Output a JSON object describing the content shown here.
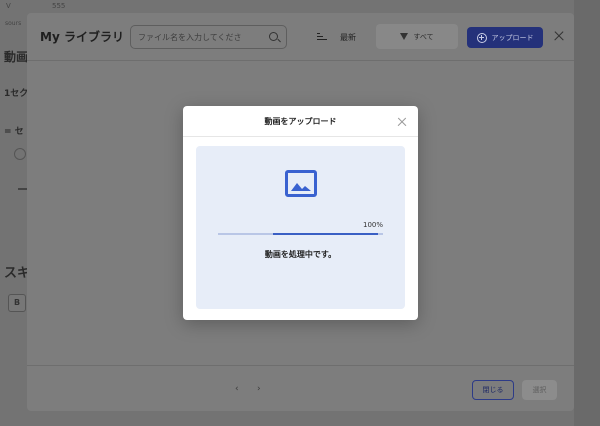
{
  "background": {
    "top_a": "V",
    "top_b": "555",
    "top_c": "sours",
    "heading1": "動画",
    "heading2": "1セク",
    "heading3": "= セ",
    "heading4": "スキ",
    "chip": "B"
  },
  "library": {
    "title": "My ライブラリ",
    "search_placeholder": "ファイル名を入力してくださ",
    "sort_label": "最新",
    "filter_label": "すべて",
    "upload_label": "アップロード",
    "pager_prev": "‹",
    "pager_next": "›",
    "close_label": "閉じる",
    "select_label": "選択"
  },
  "dialog": {
    "title": "動画をアップロード",
    "progress": 100,
    "progress_label": "100%",
    "status": "動画を処理中です。"
  },
  "colors": {
    "primary": "#3a5fc4",
    "dropzone_bg": "#e7edf8",
    "icon": "#3a62d0"
  }
}
